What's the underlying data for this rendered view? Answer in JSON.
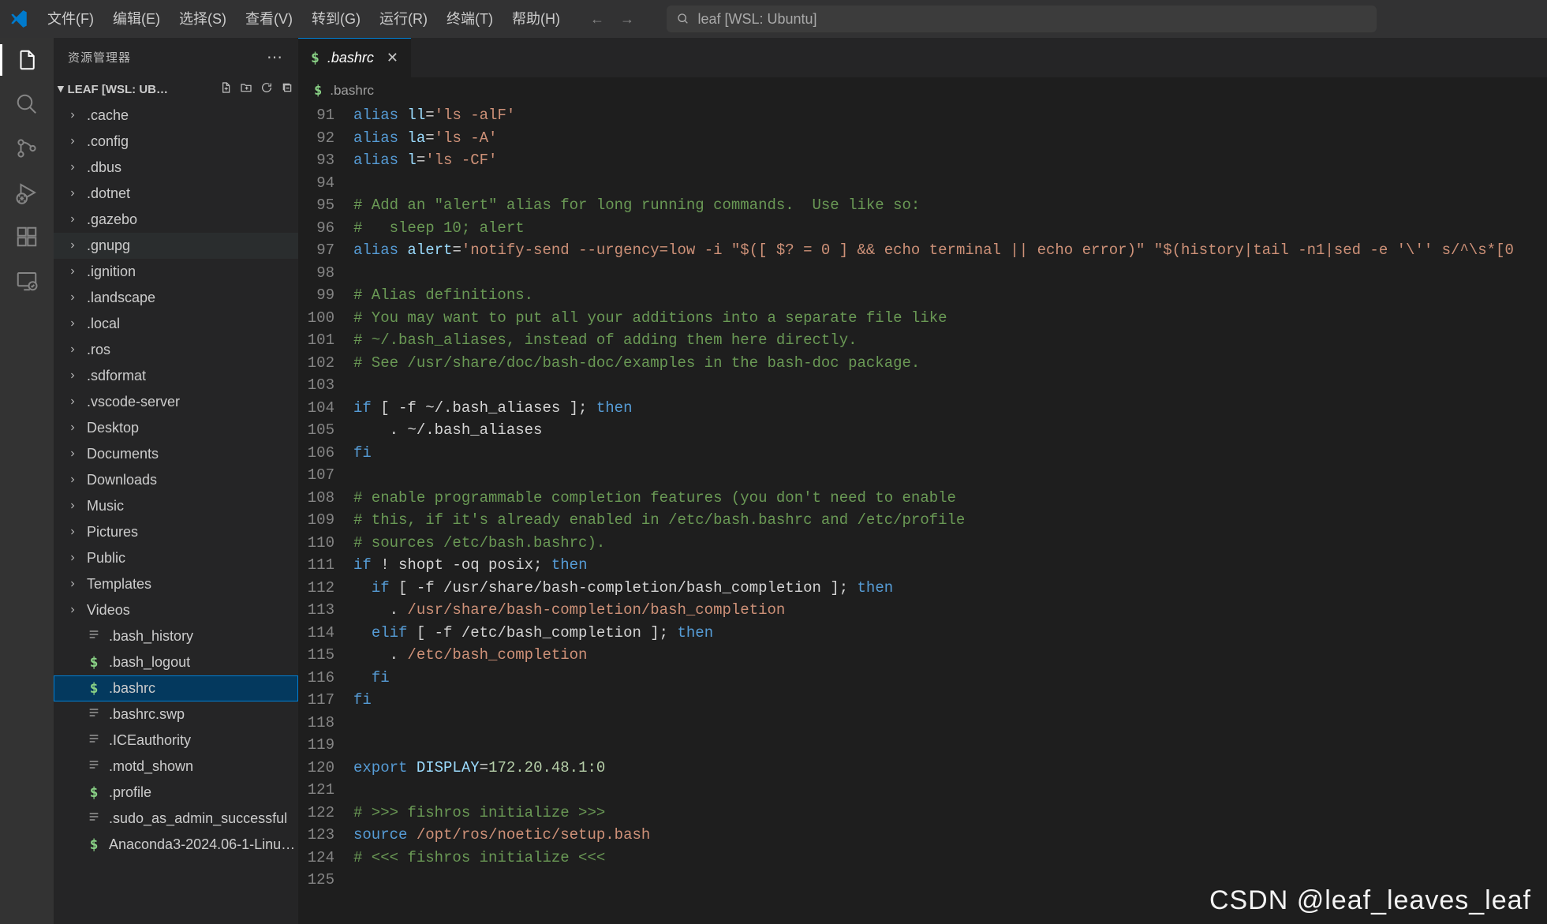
{
  "menu": {
    "items": [
      "文件(F)",
      "编辑(E)",
      "选择(S)",
      "查看(V)",
      "转到(G)",
      "运行(R)",
      "终端(T)",
      "帮助(H)"
    ]
  },
  "search": {
    "placeholder": "leaf [WSL: Ubuntu]"
  },
  "sidebar": {
    "title": "资源管理器",
    "folder_label": "LEAF [WSL: UB…",
    "tree": [
      {
        "kind": "dir",
        "label": ".cache"
      },
      {
        "kind": "dir",
        "label": ".config"
      },
      {
        "kind": "dir",
        "label": ".dbus"
      },
      {
        "kind": "dir",
        "label": ".dotnet"
      },
      {
        "kind": "dir",
        "label": ".gazebo"
      },
      {
        "kind": "dir",
        "label": ".gnupg",
        "hover": true
      },
      {
        "kind": "dir",
        "label": ".ignition"
      },
      {
        "kind": "dir",
        "label": ".landscape"
      },
      {
        "kind": "dir",
        "label": ".local"
      },
      {
        "kind": "dir",
        "label": ".ros"
      },
      {
        "kind": "dir",
        "label": ".sdformat"
      },
      {
        "kind": "dir",
        "label": ".vscode-server"
      },
      {
        "kind": "dir",
        "label": "Desktop"
      },
      {
        "kind": "dir",
        "label": "Documents"
      },
      {
        "kind": "dir",
        "label": "Downloads"
      },
      {
        "kind": "dir",
        "label": "Music"
      },
      {
        "kind": "dir",
        "label": "Pictures"
      },
      {
        "kind": "dir",
        "label": "Public"
      },
      {
        "kind": "dir",
        "label": "Templates"
      },
      {
        "kind": "dir",
        "label": "Videos"
      },
      {
        "kind": "file",
        "icon": "lines",
        "label": ".bash_history"
      },
      {
        "kind": "file",
        "icon": "dollar",
        "label": ".bash_logout"
      },
      {
        "kind": "file",
        "icon": "dollar",
        "label": ".bashrc",
        "selected": true
      },
      {
        "kind": "file",
        "icon": "lines",
        "label": ".bashrc.swp"
      },
      {
        "kind": "file",
        "icon": "lines",
        "label": ".ICEauthority"
      },
      {
        "kind": "file",
        "icon": "lines",
        "label": ".motd_shown"
      },
      {
        "kind": "file",
        "icon": "dollar",
        "label": ".profile"
      },
      {
        "kind": "file",
        "icon": "lines",
        "label": ".sudo_as_admin_successful"
      },
      {
        "kind": "file",
        "icon": "dollar",
        "label": "Anaconda3-2024.06-1-Linu…"
      }
    ]
  },
  "tab": {
    "label": ".bashrc"
  },
  "breadcrumb": {
    "label": ".bashrc"
  },
  "code": {
    "first_line_no": 91,
    "lines": [
      [
        [
          "kw",
          "alias "
        ],
        [
          "var",
          "ll"
        ],
        [
          "",
          "="
        ],
        [
          "str",
          "'ls -alF'"
        ]
      ],
      [
        [
          "kw",
          "alias "
        ],
        [
          "var",
          "la"
        ],
        [
          "",
          "="
        ],
        [
          "str",
          "'ls -A'"
        ]
      ],
      [
        [
          "kw",
          "alias "
        ],
        [
          "var",
          "l"
        ],
        [
          "",
          "="
        ],
        [
          "str",
          "'ls -CF'"
        ]
      ],
      [
        [
          "",
          ""
        ]
      ],
      [
        [
          "cmt",
          "# Add an \"alert\" alias for long running commands.  Use like so:"
        ]
      ],
      [
        [
          "cmt",
          "#   sleep 10; alert"
        ]
      ],
      [
        [
          "kw",
          "alias "
        ],
        [
          "var",
          "alert"
        ],
        [
          "",
          "="
        ],
        [
          "str",
          "'notify-send --urgency=low -i \"$([ $? = 0 ] && echo terminal || echo error)\" \"$(history|tail -n1|sed -e '\\'' s/^\\s*[0"
        ]
      ],
      [
        [
          "",
          ""
        ]
      ],
      [
        [
          "cmt",
          "# Alias definitions."
        ]
      ],
      [
        [
          "cmt",
          "# You may want to put all your additions into a separate file like"
        ]
      ],
      [
        [
          "cmt",
          "# ~/.bash_aliases, instead of adding them here directly."
        ]
      ],
      [
        [
          "cmt",
          "# See /usr/share/doc/bash-doc/examples in the bash-doc package."
        ]
      ],
      [
        [
          "",
          ""
        ]
      ],
      [
        [
          "kw",
          "if"
        ],
        [
          "",
          " [ -f ~/.bash_aliases ]; "
        ],
        [
          "kw",
          "then"
        ]
      ],
      [
        [
          "",
          "    . ~/.bash_aliases"
        ]
      ],
      [
        [
          "kw",
          "fi"
        ]
      ],
      [
        [
          "",
          ""
        ]
      ],
      [
        [
          "cmt",
          "# enable programmable completion features (you don't need to enable"
        ]
      ],
      [
        [
          "cmt",
          "# this, if it's already enabled in /etc/bash.bashrc and /etc/profile"
        ]
      ],
      [
        [
          "cmt",
          "# sources /etc/bash.bashrc)."
        ]
      ],
      [
        [
          "kw",
          "if"
        ],
        [
          "",
          " ! shopt -oq posix; "
        ],
        [
          "kw",
          "then"
        ]
      ],
      [
        [
          "",
          "  "
        ],
        [
          "kw",
          "if"
        ],
        [
          "",
          " [ -f /usr/share/bash-completion/bash_completion ]; "
        ],
        [
          "kw",
          "then"
        ]
      ],
      [
        [
          "",
          "    . "
        ],
        [
          "path",
          "/usr/share/bash-completion/bash_completion"
        ]
      ],
      [
        [
          "",
          "  "
        ],
        [
          "kw",
          "elif"
        ],
        [
          "",
          " [ -f /etc/bash_completion ]; "
        ],
        [
          "kw",
          "then"
        ]
      ],
      [
        [
          "",
          "    . "
        ],
        [
          "path",
          "/etc/bash_completion"
        ]
      ],
      [
        [
          "",
          "  "
        ],
        [
          "kw",
          "fi"
        ]
      ],
      [
        [
          "kw",
          "fi"
        ]
      ],
      [
        [
          "",
          ""
        ]
      ],
      [
        [
          "",
          ""
        ]
      ],
      [
        [
          "kw",
          "export "
        ],
        [
          "var",
          "DISPLAY"
        ],
        [
          "",
          "="
        ],
        [
          "num",
          "172.20.48.1:0"
        ]
      ],
      [
        [
          "",
          ""
        ]
      ],
      [
        [
          "cmt",
          "# >>> fishros initialize >>>"
        ]
      ],
      [
        [
          "kw",
          "source "
        ],
        [
          "path",
          "/opt/ros/noetic/setup.bash"
        ]
      ],
      [
        [
          "cmt",
          "# <<< fishros initialize <<<"
        ]
      ],
      [
        [
          "",
          ""
        ]
      ]
    ]
  },
  "watermark": "CSDN @leaf_leaves_leaf"
}
